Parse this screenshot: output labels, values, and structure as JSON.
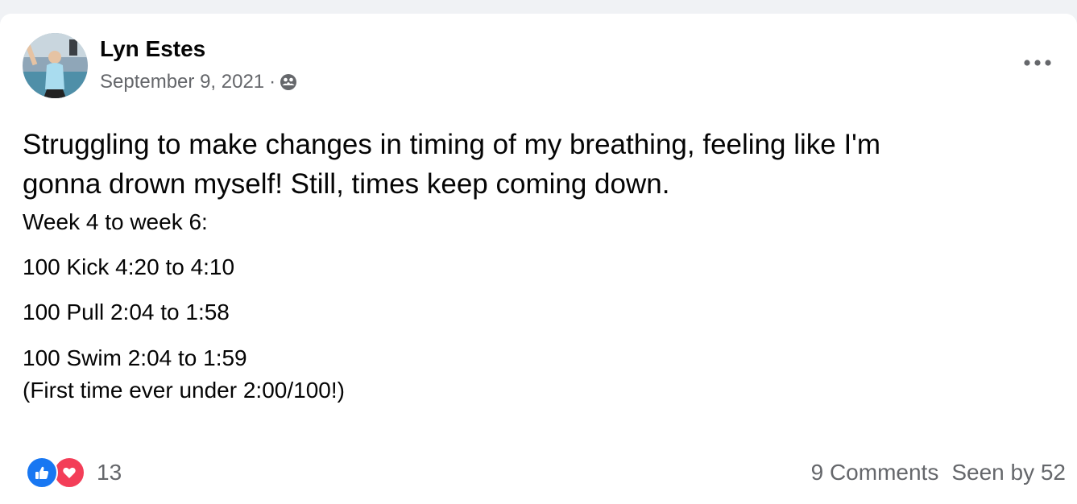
{
  "post": {
    "author": "Lyn Estes",
    "date": "September 9, 2021",
    "separator": "·",
    "audience_icon": "group-icon",
    "more_icon": "more-options-icon",
    "headline_line1": "Struggling to make changes in timing of my breathing, feeling like I'm",
    "headline_line2": "gonna drown myself! Still, times keep coming down.",
    "body": {
      "week_range": "Week 4 to week 6:",
      "kick": "100 Kick 4:20 to 4:10",
      "pull": "100 Pull 2:04 to 1:58",
      "swim": "100 Swim 2:04 to 1:59",
      "note": "(First time ever under 2:00/100!)"
    }
  },
  "footer": {
    "reaction_icons": [
      "like-icon",
      "love-icon"
    ],
    "reaction_count": "13",
    "comments": "9 Comments",
    "seen_by": "Seen by 52"
  },
  "colors": {
    "like": "#1877f2",
    "love": "#f33e58",
    "secondary_text": "#65676b",
    "primary_text": "#050505",
    "page_background": "#f0f2f5"
  }
}
